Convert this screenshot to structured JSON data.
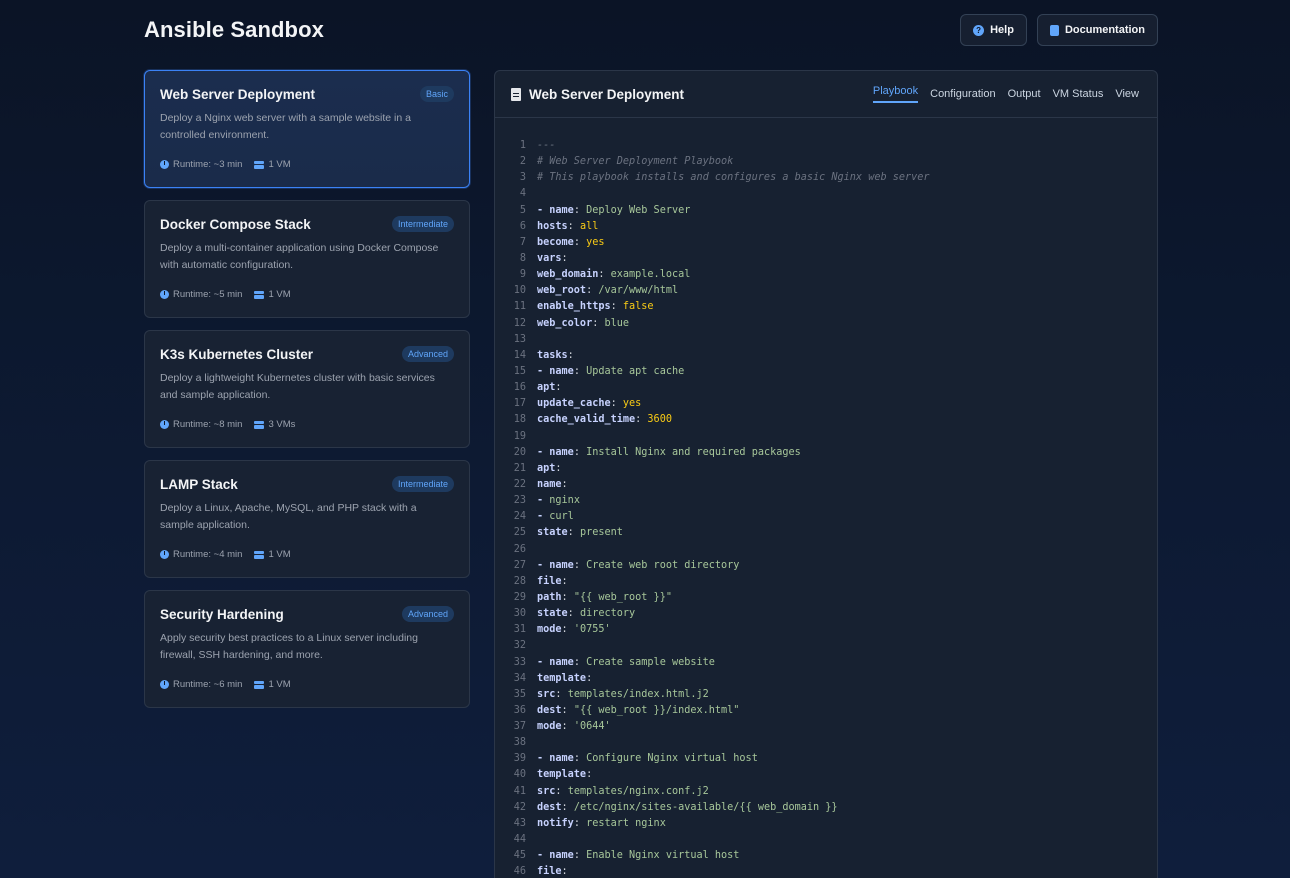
{
  "app": {
    "title": "Ansible Sandbox",
    "help_label": "Help",
    "docs_label": "Documentation"
  },
  "scenarios": [
    {
      "title": "Web Server Deployment",
      "badge": "Basic",
      "description": "Deploy a Nginx web server with a sample website in a controlled environment.",
      "runtime": "Runtime: ~3 min",
      "vms": "1 VM",
      "active": true
    },
    {
      "title": "Docker Compose Stack",
      "badge": "Intermediate",
      "description": "Deploy a multi-container application using Docker Compose with automatic configuration.",
      "runtime": "Runtime: ~5 min",
      "vms": "1 VM",
      "active": false
    },
    {
      "title": "K3s Kubernetes Cluster",
      "badge": "Advanced",
      "description": "Deploy a lightweight Kubernetes cluster with basic services and sample application.",
      "runtime": "Runtime: ~8 min",
      "vms": "3 VMs",
      "active": false
    },
    {
      "title": "LAMP Stack",
      "badge": "Intermediate",
      "description": "Deploy a Linux, Apache, MySQL, and PHP stack with a sample application.",
      "runtime": "Runtime: ~4 min",
      "vms": "1 VM",
      "active": false
    },
    {
      "title": "Security Hardening",
      "badge": "Advanced",
      "description": "Apply security best practices to a Linux server including firewall, SSH hardening, and more.",
      "runtime": "Runtime: ~6 min",
      "vms": "1 VM",
      "active": false
    }
  ],
  "panel": {
    "title": "Web Server Deployment",
    "tabs": [
      "Playbook",
      "Configuration",
      "Output",
      "VM Status",
      "View"
    ],
    "active_tab": "Playbook"
  },
  "code_lines": [
    [
      [
        "c",
        "---"
      ]
    ],
    [
      [
        "c",
        "# Web Server Deployment Playbook"
      ]
    ],
    [
      [
        "c",
        "# This playbook installs and configures a basic Nginx web server"
      ]
    ],
    [],
    [
      [
        "k",
        "- name"
      ],
      [
        "t",
        ": "
      ],
      [
        "s",
        "Deploy Web Server"
      ]
    ],
    [
      [
        "k",
        "hosts"
      ],
      [
        "t",
        ": "
      ],
      [
        "y",
        "all"
      ]
    ],
    [
      [
        "k",
        "become"
      ],
      [
        "t",
        ": "
      ],
      [
        "y",
        "yes"
      ]
    ],
    [
      [
        "k",
        "vars"
      ],
      [
        "t",
        ":"
      ]
    ],
    [
      [
        "k",
        "web_domain"
      ],
      [
        "t",
        ": "
      ],
      [
        "s",
        "example.local"
      ]
    ],
    [
      [
        "k",
        "web_root"
      ],
      [
        "t",
        ": "
      ],
      [
        "s",
        "/var/www/html"
      ]
    ],
    [
      [
        "k",
        "enable_https"
      ],
      [
        "t",
        ": "
      ],
      [
        "y",
        "false"
      ]
    ],
    [
      [
        "k",
        "web_color"
      ],
      [
        "t",
        ": "
      ],
      [
        "s",
        "blue"
      ]
    ],
    [],
    [
      [
        "k",
        "tasks"
      ],
      [
        "t",
        ":"
      ]
    ],
    [
      [
        "k",
        "- name"
      ],
      [
        "t",
        ": "
      ],
      [
        "s",
        "Update apt cache"
      ]
    ],
    [
      [
        "k",
        "apt"
      ],
      [
        "t",
        ":"
      ]
    ],
    [
      [
        "k",
        "update_cache"
      ],
      [
        "t",
        ": "
      ],
      [
        "y",
        "yes"
      ]
    ],
    [
      [
        "k",
        "cache_valid_time"
      ],
      [
        "t",
        ": "
      ],
      [
        "y",
        "3600"
      ]
    ],
    [],
    [
      [
        "k",
        "- name"
      ],
      [
        "t",
        ": "
      ],
      [
        "s",
        "Install Nginx and required packages"
      ]
    ],
    [
      [
        "k",
        "apt"
      ],
      [
        "t",
        ":"
      ]
    ],
    [
      [
        "k",
        "name"
      ],
      [
        "t",
        ":"
      ]
    ],
    [
      [
        "k",
        "- "
      ],
      [
        "s",
        "nginx"
      ]
    ],
    [
      [
        "k",
        "- "
      ],
      [
        "s",
        "curl"
      ]
    ],
    [
      [
        "k",
        "state"
      ],
      [
        "t",
        ": "
      ],
      [
        "s",
        "present"
      ]
    ],
    [],
    [
      [
        "k",
        "- name"
      ],
      [
        "t",
        ": "
      ],
      [
        "s",
        "Create web root directory"
      ]
    ],
    [
      [
        "k",
        "file"
      ],
      [
        "t",
        ":"
      ]
    ],
    [
      [
        "k",
        "path"
      ],
      [
        "t",
        ": "
      ],
      [
        "s",
        "\"{{ web_root }}\""
      ]
    ],
    [
      [
        "k",
        "state"
      ],
      [
        "t",
        ": "
      ],
      [
        "s",
        "directory"
      ]
    ],
    [
      [
        "k",
        "mode"
      ],
      [
        "t",
        ": "
      ],
      [
        "s",
        "'0755'"
      ]
    ],
    [],
    [
      [
        "k",
        "- name"
      ],
      [
        "t",
        ": "
      ],
      [
        "s",
        "Create sample website"
      ]
    ],
    [
      [
        "k",
        "template"
      ],
      [
        "t",
        ":"
      ]
    ],
    [
      [
        "k",
        "src"
      ],
      [
        "t",
        ": "
      ],
      [
        "s",
        "templates/index.html.j2"
      ]
    ],
    [
      [
        "k",
        "dest"
      ],
      [
        "t",
        ": "
      ],
      [
        "s",
        "\"{{ web_root }}/index.html\""
      ]
    ],
    [
      [
        "k",
        "mode"
      ],
      [
        "t",
        ": "
      ],
      [
        "s",
        "'0644'"
      ]
    ],
    [],
    [
      [
        "k",
        "- name"
      ],
      [
        "t",
        ": "
      ],
      [
        "s",
        "Configure Nginx virtual host"
      ]
    ],
    [
      [
        "k",
        "template"
      ],
      [
        "t",
        ":"
      ]
    ],
    [
      [
        "k",
        "src"
      ],
      [
        "t",
        ": "
      ],
      [
        "s",
        "templates/nginx.conf.j2"
      ]
    ],
    [
      [
        "k",
        "dest"
      ],
      [
        "t",
        ": "
      ],
      [
        "s",
        "/etc/nginx/sites-available/{{ web_domain }}"
      ]
    ],
    [
      [
        "k",
        "notify"
      ],
      [
        "t",
        ": "
      ],
      [
        "s",
        "restart nginx"
      ]
    ],
    [],
    [
      [
        "k",
        "- name"
      ],
      [
        "t",
        ": "
      ],
      [
        "s",
        "Enable Nginx virtual host"
      ]
    ],
    [
      [
        "k",
        "file"
      ],
      [
        "t",
        ":"
      ]
    ]
  ]
}
